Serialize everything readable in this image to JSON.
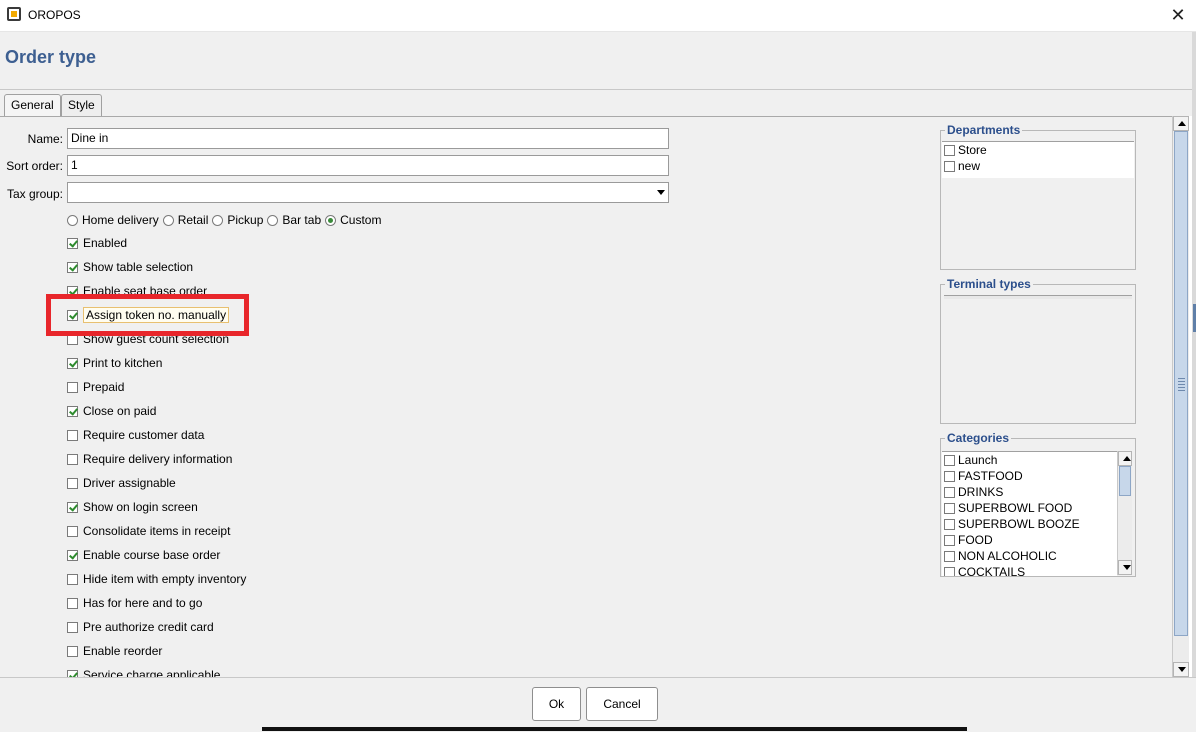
{
  "window": {
    "title": "OROPOS",
    "close_glyph": "✕",
    "app_icon": "oropos-logo-icon"
  },
  "header": {
    "title": "Order type"
  },
  "tabs": [
    {
      "label": "General"
    },
    {
      "label": "Style"
    }
  ],
  "form": {
    "name_label": "Name:",
    "name_value": "Dine in",
    "sort_label": "Sort order:",
    "sort_value": "1",
    "tax_label": "Tax group:",
    "tax_value": ""
  },
  "radios": [
    {
      "label": "Home delivery",
      "selected": false
    },
    {
      "label": "Retail",
      "selected": false
    },
    {
      "label": "Pickup",
      "selected": false
    },
    {
      "label": "Bar tab",
      "selected": false
    },
    {
      "label": "Custom",
      "selected": true
    }
  ],
  "checkboxes": [
    {
      "label": "Enabled",
      "checked": true
    },
    {
      "label": "Show table selection",
      "checked": true
    },
    {
      "label": "Enable seat base order",
      "checked": true
    },
    {
      "label": "Assign token no. manually",
      "checked": true
    },
    {
      "label": "Show guest count selection",
      "checked": false
    },
    {
      "label": "Print to kitchen",
      "checked": true
    },
    {
      "label": "Prepaid",
      "checked": false
    },
    {
      "label": "Close on paid",
      "checked": true
    },
    {
      "label": "Require customer data",
      "checked": false
    },
    {
      "label": "Require delivery information",
      "checked": false
    },
    {
      "label": "Driver assignable",
      "checked": false
    },
    {
      "label": "Show on login screen",
      "checked": true
    },
    {
      "label": "Consolidate items in receipt",
      "checked": false
    },
    {
      "label": "Enable course base order",
      "checked": true
    },
    {
      "label": "Hide item with empty inventory",
      "checked": false
    },
    {
      "label": "Has for here and to go",
      "checked": false
    },
    {
      "label": "Pre authorize credit card",
      "checked": false
    },
    {
      "label": "Enable reorder",
      "checked": false
    },
    {
      "label": "Service charge applicable",
      "checked": true
    }
  ],
  "departments": {
    "title": "Departments",
    "items": [
      {
        "label": "Store",
        "checked": false
      },
      {
        "label": "new",
        "checked": false
      }
    ]
  },
  "terminal_types": {
    "title": "Terminal types",
    "items": []
  },
  "categories": {
    "title": "Categories",
    "items": [
      {
        "label": "Launch",
        "checked": false
      },
      {
        "label": "FASTFOOD",
        "checked": false
      },
      {
        "label": "DRINKS",
        "checked": false
      },
      {
        "label": "SUPERBOWL FOOD",
        "checked": false
      },
      {
        "label": "SUPERBOWL BOOZE",
        "checked": false
      },
      {
        "label": "FOOD",
        "checked": false
      },
      {
        "label": "NON ALCOHOLIC",
        "checked": false
      },
      {
        "label": "COCKTAILS",
        "checked": false
      }
    ]
  },
  "footer": {
    "ok_label": "Ok",
    "cancel_label": "Cancel"
  },
  "colors": {
    "heading": "#3d5f91",
    "group_title": "#2c4f8c",
    "highlight": "#e8262b",
    "check": "#2e8b2e"
  }
}
